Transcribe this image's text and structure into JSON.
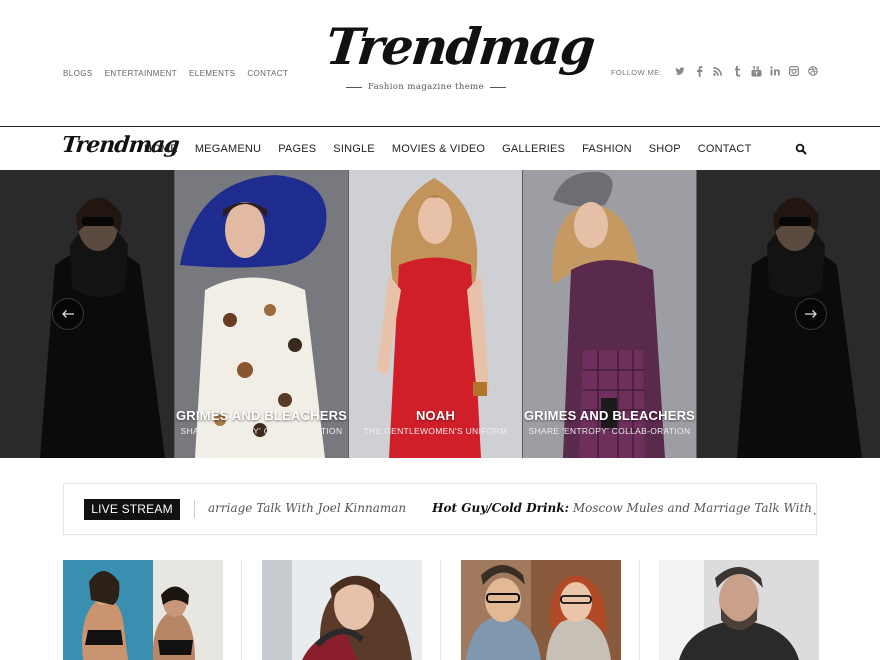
{
  "header": {
    "links": [
      "BLOGS",
      "ENTERTAINMENT",
      "ELEMENTS",
      "CONTACT"
    ],
    "logo_text": "Trendmag",
    "tagline": "Fashion magazine theme",
    "follow_label": "FOLLOW ME:",
    "social_icons": [
      "twitter-icon",
      "facebook-icon",
      "rss-icon",
      "tumblr-icon",
      "youtube-icon",
      "linkedin-icon",
      "instagram-icon",
      "dribbble-icon"
    ]
  },
  "nav": {
    "logo_text": "Trendmag",
    "items": [
      "HOME",
      "MEGAMENU",
      "PAGES",
      "SINGLE",
      "MOVIES & VIDEO",
      "GALLERIES",
      "FASHION",
      "SHOP",
      "CONTACT"
    ],
    "search_icon": "search-icon"
  },
  "slider": {
    "slides": [
      {
        "title": "",
        "subtitle": ""
      },
      {
        "title": "GRIMES AND BLEACHERS",
        "subtitle": "SHARE 'ENTROPY' COLLAB-ORATION"
      },
      {
        "title": "NOAH",
        "subtitle": "THE GENTLEWOMEN'S UNIFORM"
      },
      {
        "title": "GRIMES AND BLEACHERS",
        "subtitle": "SHARE 'ENTROPY' COLLAB-ORATION"
      },
      {
        "title": "",
        "subtitle": ""
      }
    ],
    "prev_icon": "arrow-left-icon",
    "next_icon": "arrow-right-icon"
  },
  "live_stream": {
    "label": "LIVE STREAM",
    "item1_text": "arriage Talk With Joel Kinnaman",
    "item2_bold": "Hot Guy/Cold Drink:",
    "item2_text": "Moscow Mules and Marriage Talk With Joel"
  },
  "colors": {
    "accent": "#111111",
    "dress_red": "#d11f2a",
    "hat_blue": "#1f2c8f",
    "purple": "#5a2a4c"
  }
}
